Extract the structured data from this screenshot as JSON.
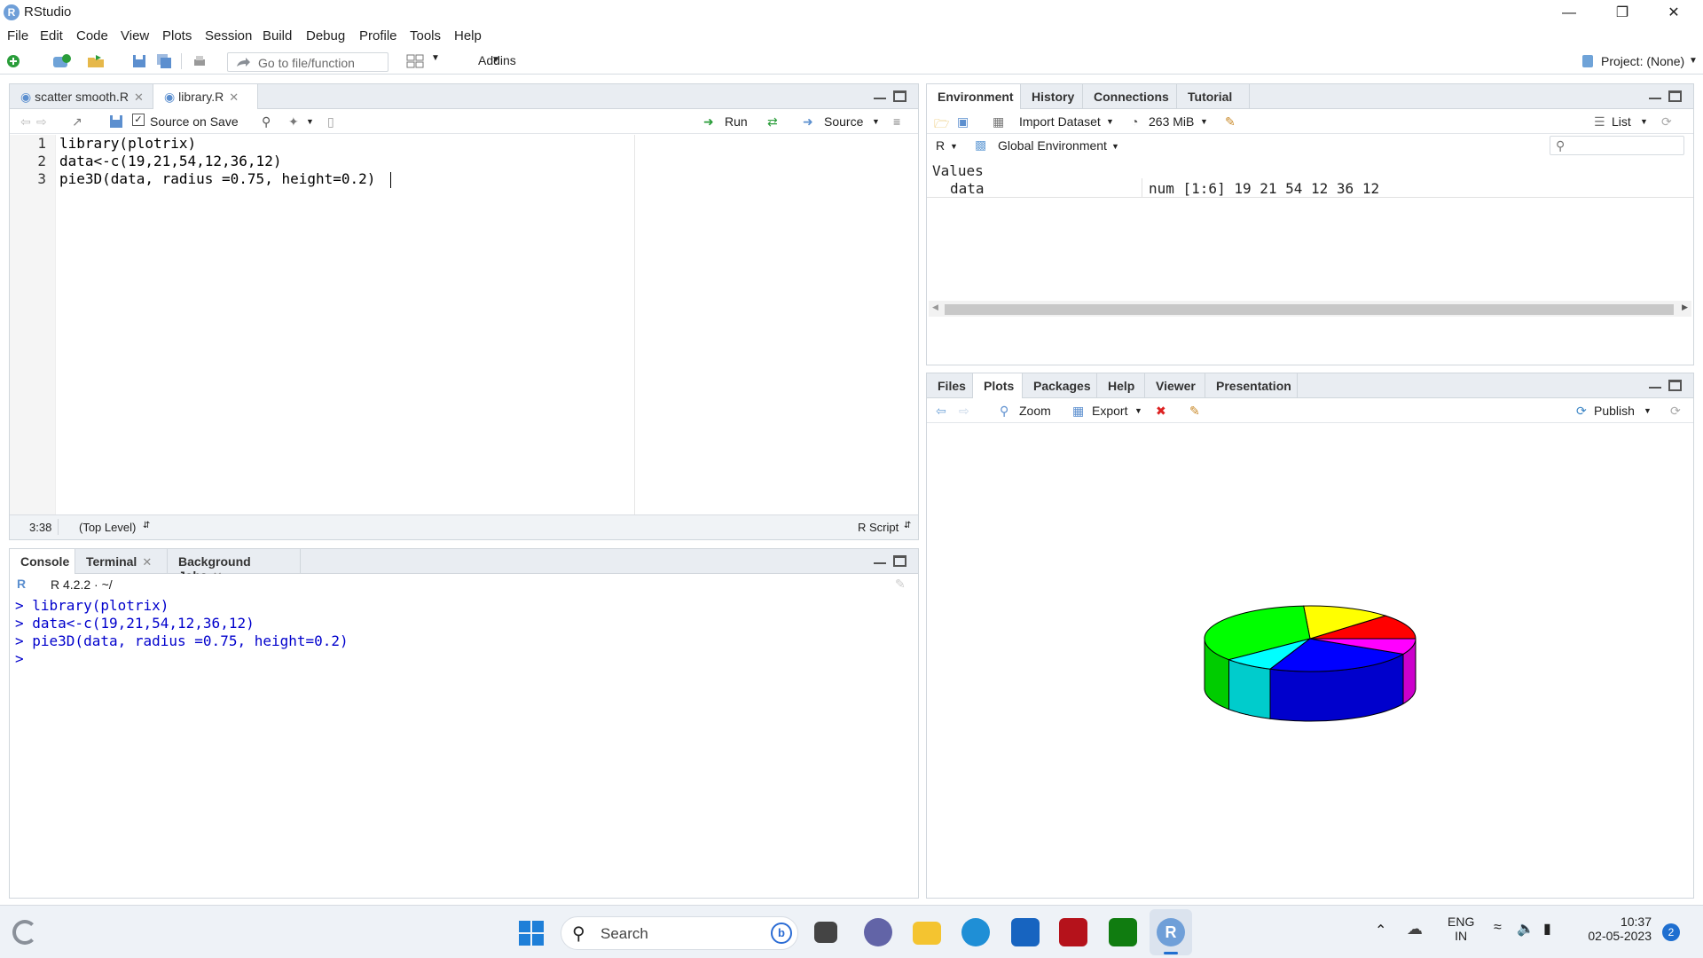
{
  "window": {
    "title": "RStudio",
    "app_icon_letter": "R"
  },
  "menu": [
    "File",
    "Edit",
    "Code",
    "View",
    "Plots",
    "Session",
    "Build",
    "Debug",
    "Profile",
    "Tools",
    "Help"
  ],
  "toolbar": {
    "goto_placeholder": "Go to file/function",
    "addins_label": "Addins",
    "project_label": "Project: (None)"
  },
  "editor": {
    "tabs": [
      {
        "label": "scatter smooth.R"
      },
      {
        "label": "library.R"
      }
    ],
    "source_on_save": "Source on Save",
    "run_label": "Run",
    "source_label": "Source",
    "lines": [
      "library(plotrix)",
      "data<-c(19,21,54,12,36,12)",
      "pie3D(data, radius =0.75, height=0.2)"
    ],
    "line_numbers": [
      "1",
      "2",
      "3"
    ],
    "status_pos": "3:38",
    "status_scope": "(Top Level)",
    "status_type": "R Script"
  },
  "console": {
    "tabs": [
      "Console",
      "Terminal",
      "Background Jobs"
    ],
    "r_version": "R 4.2.2 · ~/",
    "lines": [
      "> library(plotrix)",
      "> data<-c(19,21,54,12,36,12)",
      "> pie3D(data, radius =0.75, height=0.2)",
      ">"
    ]
  },
  "environment": {
    "tabs": [
      "Environment",
      "History",
      "Connections",
      "Tutorial"
    ],
    "import_label": "Import Dataset",
    "memory_label": "263 MiB",
    "list_label": "List",
    "lang_label": "R",
    "scope_label": "Global Environment",
    "section": "Values",
    "row_name": "data",
    "row_value": "num [1:6] 19 21 54 12 36 12"
  },
  "plots": {
    "tabs": [
      "Files",
      "Plots",
      "Packages",
      "Help",
      "Viewer",
      "Presentation"
    ],
    "zoom_label": "Zoom",
    "export_label": "Export",
    "publish_label": "Publish"
  },
  "chart_data": {
    "type": "pie",
    "values": [
      19,
      21,
      54,
      12,
      36,
      12
    ],
    "colors": [
      "#ff0000",
      "#ffff00",
      "#00ff00",
      "#00ffff",
      "#0000ff",
      "#ff00ff"
    ],
    "title": "",
    "three_d": true
  },
  "taskbar": {
    "search_label": "Search",
    "lang_line1": "ENG",
    "lang_line2": "IN",
    "time": "10:37",
    "date": "02-05-2023",
    "badge": "2"
  }
}
